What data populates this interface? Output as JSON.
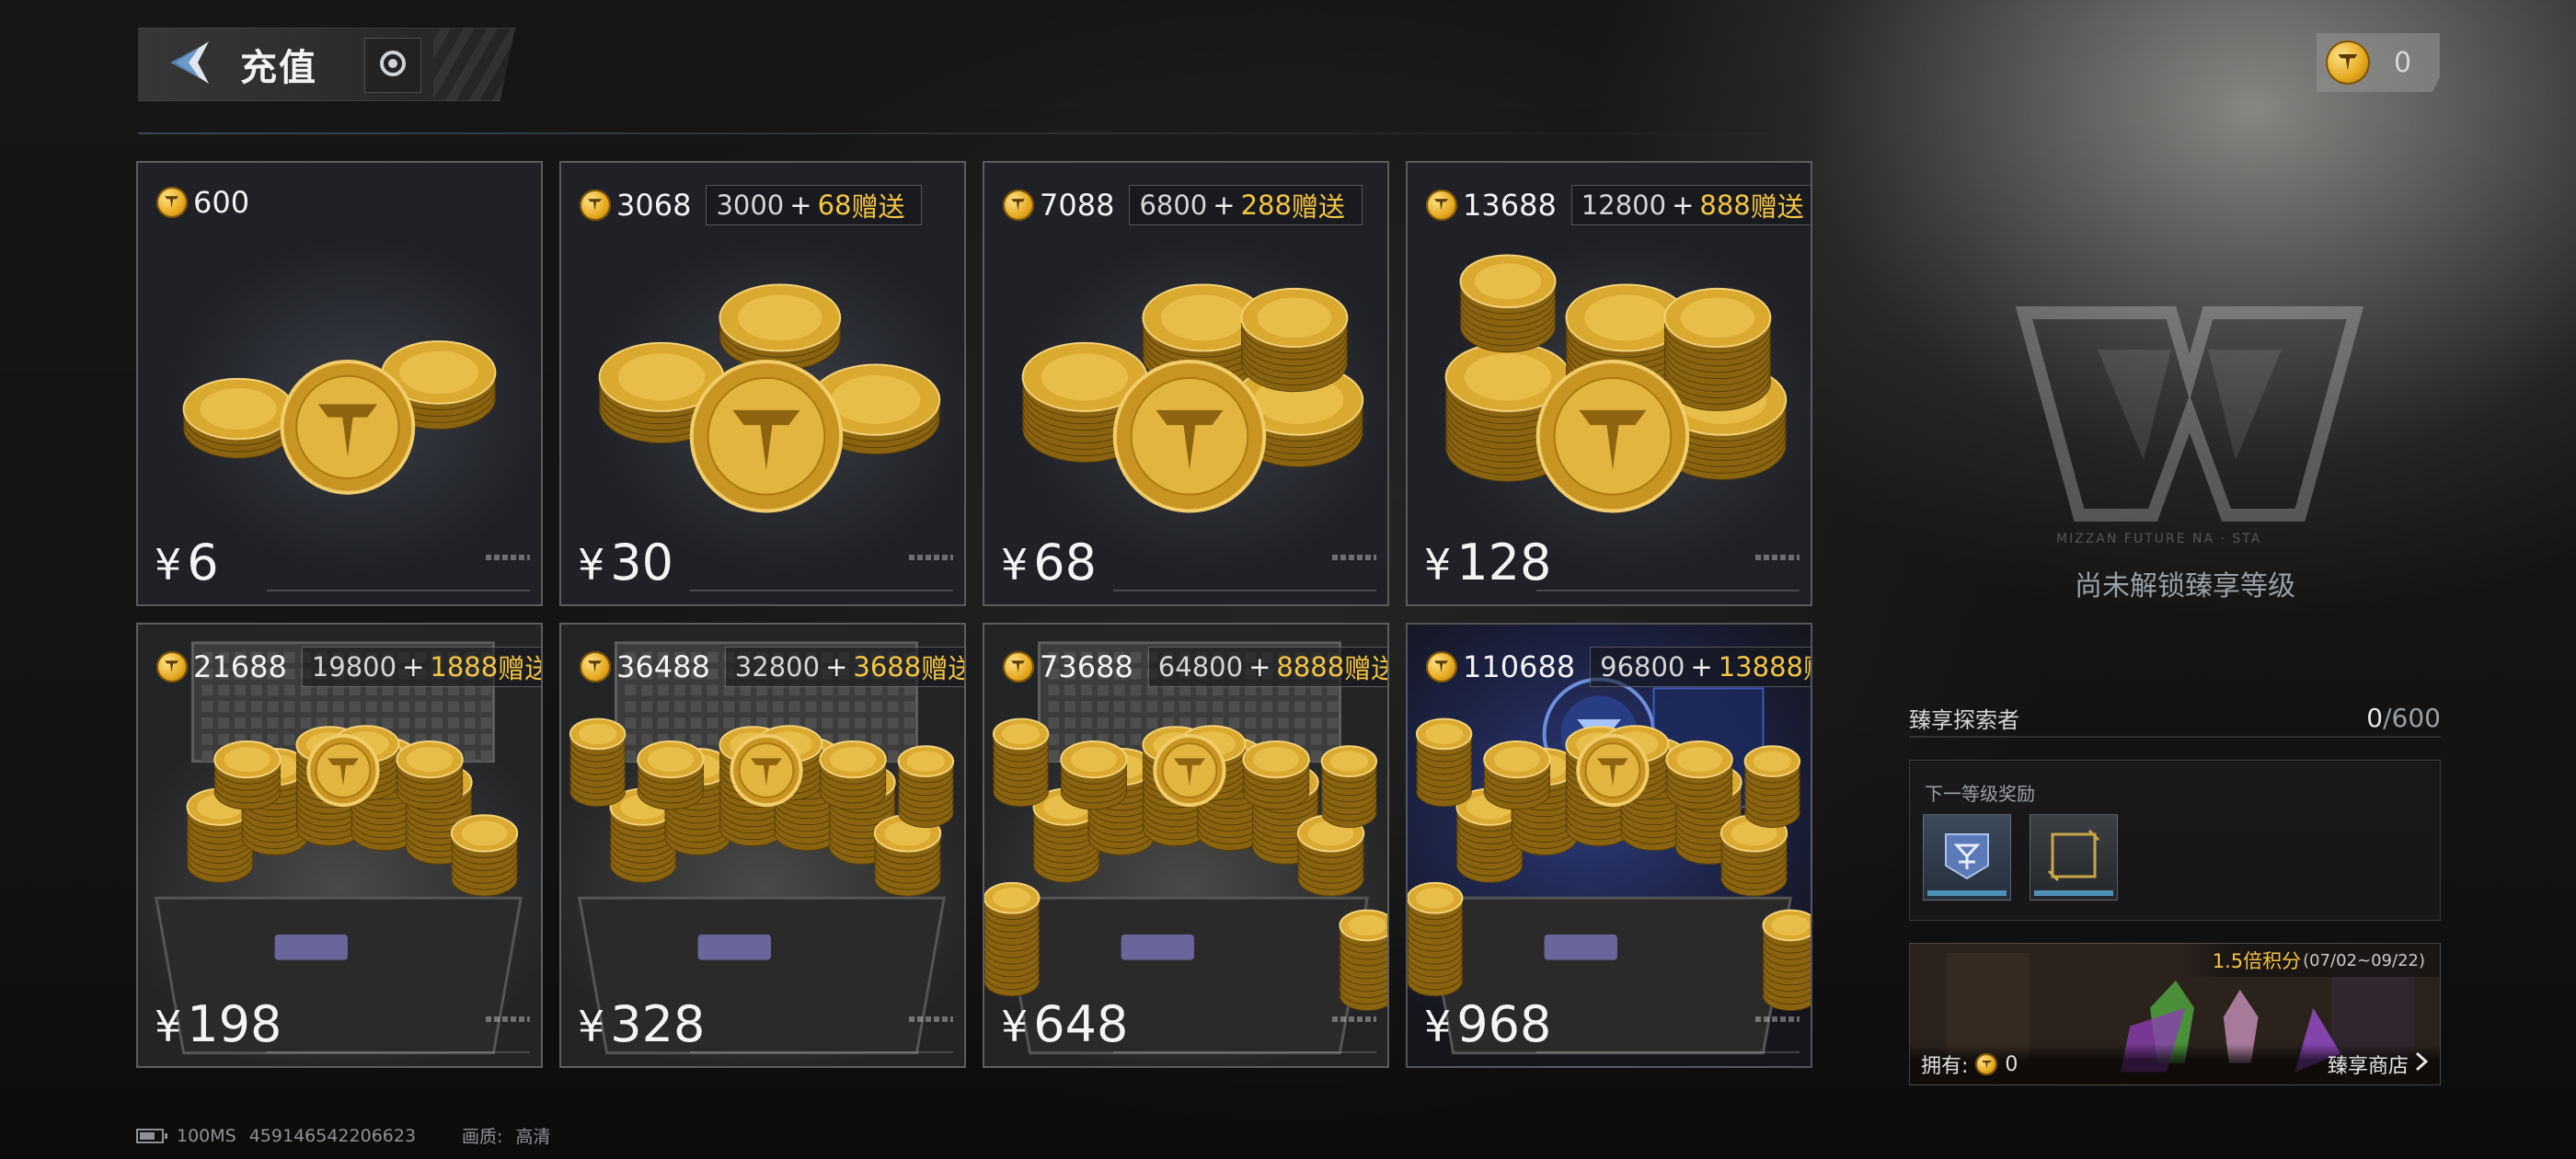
{
  "header": {
    "title": "充值",
    "back_icon": "back-chevron-icon",
    "extra_icon": "record-icon"
  },
  "currency_top": {
    "icon": "coin-icon",
    "amount": "0"
  },
  "packs": [
    {
      "amount": "600",
      "base": "",
      "bonus": "",
      "gift_label": "",
      "price": "6",
      "art": "small-coins"
    },
    {
      "amount": "3068",
      "base": "3000",
      "bonus": "68",
      "gift_label": "赠送",
      "price": "30",
      "art": "coins"
    },
    {
      "amount": "7088",
      "base": "6800",
      "bonus": "288",
      "gift_label": "赠送",
      "price": "68",
      "art": "coins"
    },
    {
      "amount": "13688",
      "base": "12800",
      "bonus": "888",
      "gift_label": "赠送",
      "price": "128",
      "art": "coins"
    },
    {
      "amount": "21688",
      "base": "19800",
      "bonus": "1888",
      "gift_label": "赠送",
      "price": "198",
      "art": "chest"
    },
    {
      "amount": "36488",
      "base": "32800",
      "bonus": "3688",
      "gift_label": "赠送",
      "price": "328",
      "art": "chest"
    },
    {
      "amount": "73688",
      "base": "64800",
      "bonus": "8888",
      "gift_label": "赠送",
      "price": "648",
      "art": "chest"
    },
    {
      "amount": "110688",
      "base": "96800",
      "bonus": "13888",
      "gift_label": "赠送",
      "price": "968",
      "art": "tech"
    }
  ],
  "currency_symbol": "¥",
  "vip": {
    "emblem_caption": "MIZZAN FUTURE NA · STA",
    "locked_text": "尚未解锁臻享等级",
    "tier_name": "臻享探索者",
    "progress_current": "0",
    "progress_max": "/600",
    "reward_title": "下一等级奖励",
    "rewards": [
      "badge-reward-icon",
      "frame-reward-icon"
    ]
  },
  "shop": {
    "promo": "1.5倍积分",
    "promo_dates": "(07/02~09/22)",
    "own_label": "拥有:",
    "own_amount": "0",
    "link_label": "臻享商店"
  },
  "status": {
    "ping": "100MS",
    "uid": "459146542206623",
    "quality_label": "画质:",
    "quality_value": "高清"
  },
  "colors": {
    "gold": "#f4c543",
    "accent_blue": "#4e8fb8"
  }
}
